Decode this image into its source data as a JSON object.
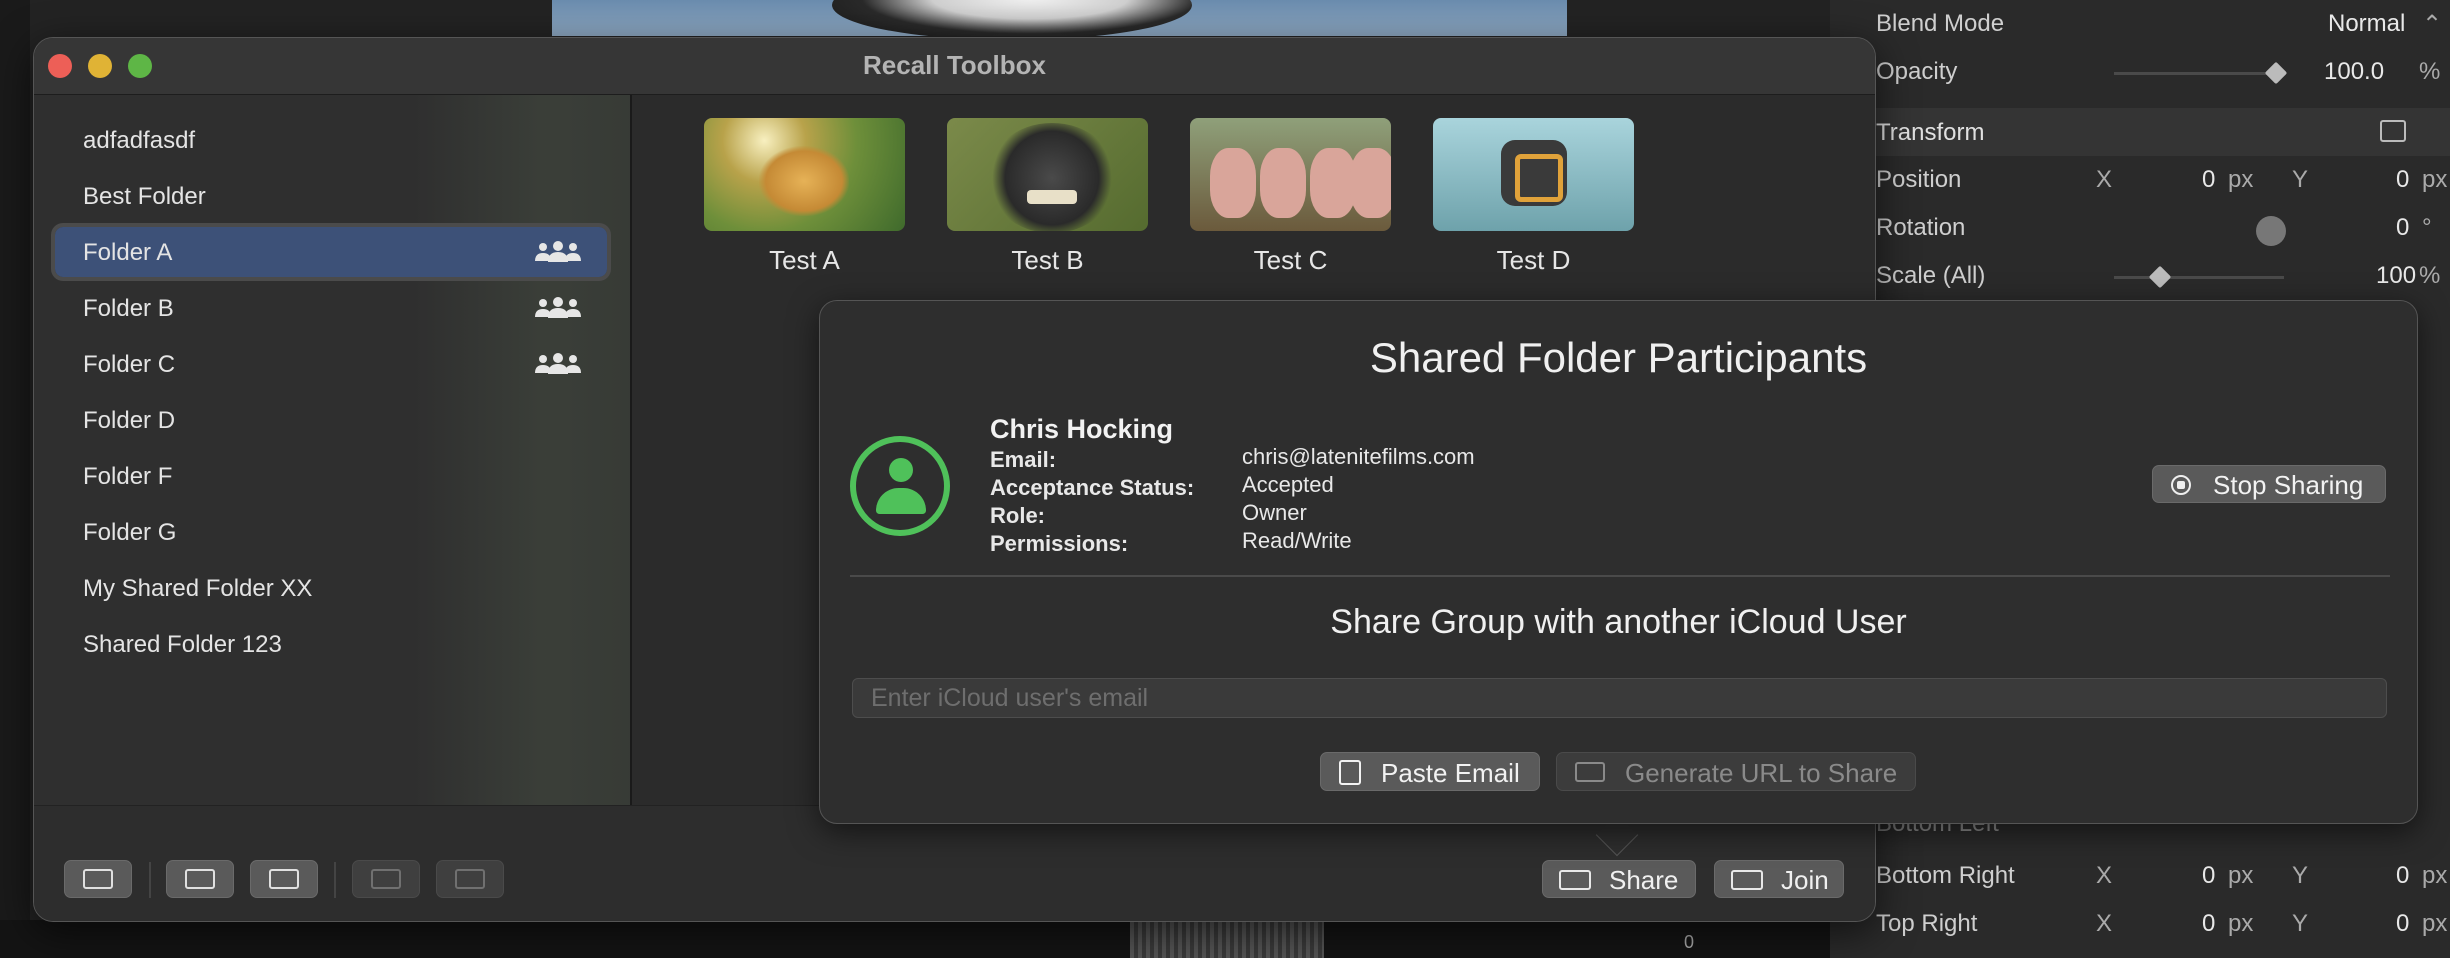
{
  "window": {
    "title": "Recall Toolbox"
  },
  "sidebar": {
    "items": [
      {
        "label": "adfadfasdf",
        "shared": false,
        "selected": false
      },
      {
        "label": "Best Folder",
        "shared": false,
        "selected": false
      },
      {
        "label": "Folder A",
        "shared": true,
        "selected": true
      },
      {
        "label": "Folder B",
        "shared": true,
        "selected": false
      },
      {
        "label": "Folder C",
        "shared": true,
        "selected": false
      },
      {
        "label": "Folder D",
        "shared": false,
        "selected": false
      },
      {
        "label": "Folder F",
        "shared": false,
        "selected": false
      },
      {
        "label": "Folder G",
        "shared": false,
        "selected": false
      },
      {
        "label": "My Shared Folder XX",
        "shared": false,
        "selected": false
      },
      {
        "label": "Shared Folder 123",
        "shared": false,
        "selected": false
      }
    ]
  },
  "content": {
    "tiles": [
      {
        "label": "Test A",
        "icon": "golden-retriever-thumbnail"
      },
      {
        "label": "Test B",
        "icon": "monkey-selfie-thumbnail"
      },
      {
        "label": "Test C",
        "icon": "pigs-thumbnail"
      },
      {
        "label": "Test D",
        "icon": "app-icon-thumbnail"
      }
    ]
  },
  "toolbar": {
    "share_label": "Share",
    "join_label": "Join"
  },
  "popover": {
    "title": "Shared Folder Participants",
    "participant": {
      "name": "Chris Hocking",
      "email_key": "Email:",
      "email": "chris@latenitefilms.com",
      "status_key": "Acceptance Status:",
      "status": "Accepted",
      "role_key": "Role:",
      "role": "Owner",
      "permissions_key": "Permissions:",
      "permissions": "Read/Write"
    },
    "stop_sharing_label": "Stop Sharing",
    "share_heading": "Share Group with another iCloud User",
    "email_placeholder": "Enter iCloud user's email",
    "paste_label": "Paste Email",
    "generate_label": "Generate URL to Share"
  },
  "inspector": {
    "blend_mode_label": "Blend Mode",
    "blend_mode_value": "Normal",
    "opacity_label": "Opacity",
    "opacity_value": "100.0",
    "opacity_unit": "%",
    "transform_label": "Transform",
    "position_label": "Position",
    "position_x": "0",
    "position_y": "0",
    "px": "px",
    "x_axis": "X",
    "y_axis": "Y",
    "rotation_label": "Rotation",
    "rotation_value": "0",
    "degree": "°",
    "scale_label": "Scale (All)",
    "scale_value": "100",
    "pct": "%",
    "bottom_left_label": "Bottom Left",
    "bottom_right_label": "Bottom Right",
    "bottom_right_x": "0",
    "bottom_right_y": "0",
    "top_right_label": "Top Right",
    "top_right_x": "0",
    "top_right_y": "0",
    "timeline_number": "0"
  },
  "colors": {
    "selection": "#3d5178",
    "avatar_green": "#4fc15a",
    "close": "#ed5f57",
    "minimize": "#e0b335",
    "maximize": "#5eb646"
  }
}
